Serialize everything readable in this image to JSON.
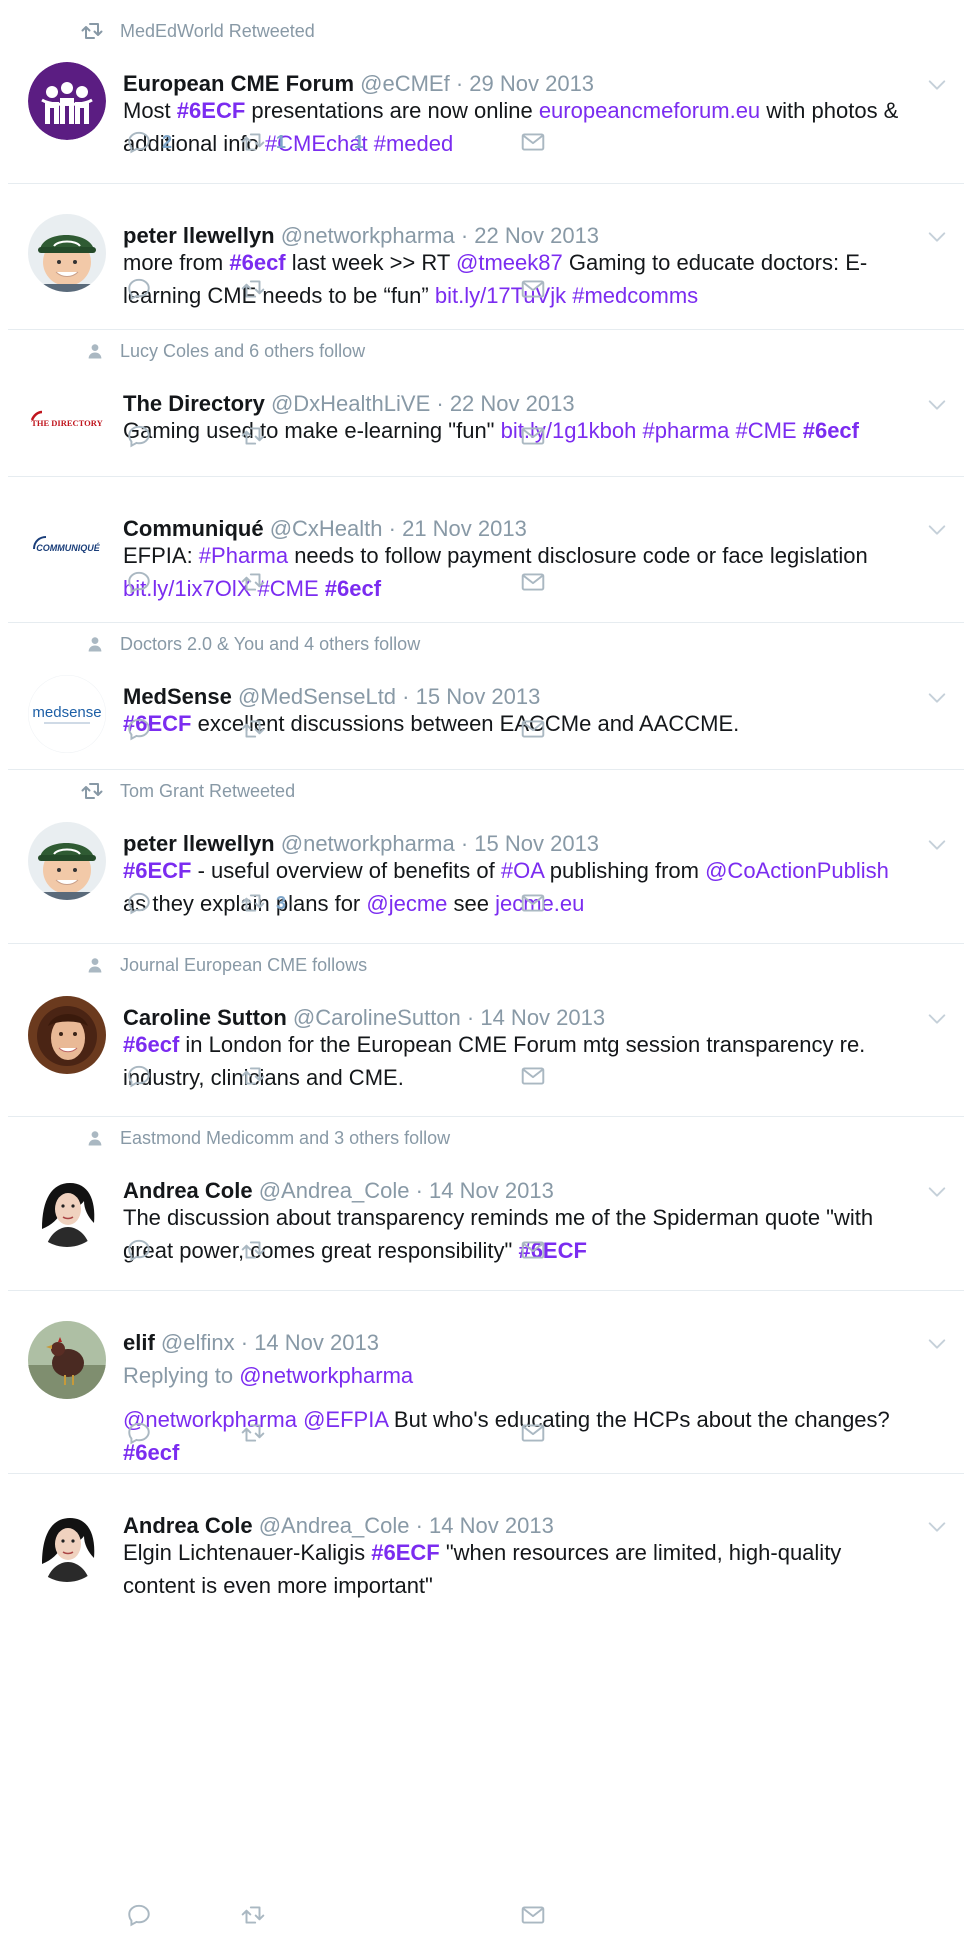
{
  "timeline": [
    {
      "context": {
        "type": "retweet",
        "text": "MedEdWorld Retweeted"
      },
      "avatar": "ecf-logo",
      "name": "European CME Forum",
      "handle": "@eCMEf",
      "date": "· 29 Nov 2013",
      "body": [
        [
          {
            "t": "Most "
          },
          {
            "t": "#6ECF",
            "c": "tag b"
          },
          {
            "t": " presentations are now online "
          },
          {
            "t": "europeancmeforum.eu",
            "c": "link"
          },
          {
            "t": " with photos &"
          }
        ],
        [
          {
            "t": "additional info "
          },
          {
            "t": "#CMEchat",
            "c": "tag"
          },
          {
            "t": " "
          },
          {
            "t": "#meded",
            "c": "tag"
          }
        ]
      ],
      "counts": {
        "replies": "2",
        "retweets": "1",
        "likes": "1"
      }
    },
    {
      "avatar": "peter-photo",
      "name": "peter llewellyn",
      "handle": "@networkpharma",
      "date": "· 22 Nov 2013",
      "body": [
        [
          {
            "t": "more from "
          },
          {
            "t": "#6ecf",
            "c": "tag b"
          },
          {
            "t": " last week >> RT "
          },
          {
            "t": "@tmeek87",
            "c": "link"
          },
          {
            "t": " Gaming to educate doctors: E-"
          }
        ],
        [
          {
            "t": "learning CME needs to be “fun” "
          },
          {
            "t": "bit.ly/17TuVjk",
            "c": "link"
          },
          {
            "t": " "
          },
          {
            "t": "#medcomms",
            "c": "tag"
          }
        ]
      ],
      "counts": {
        "replies": "",
        "retweets": "",
        "likes": ""
      }
    },
    {
      "context": {
        "type": "follow",
        "text": "Lucy Coles and 6 others follow"
      },
      "avatar": "directory-logo",
      "avatar_text": "THE DIRECTORY",
      "name": "The Directory",
      "handle": "@DxHealthLiVE",
      "date": "· 22 Nov 2013",
      "body": [
        [
          {
            "t": "Gaming used to make e-learning \"fun\" "
          },
          {
            "t": "bit.ly/1g1kboh",
            "c": "link"
          },
          {
            "t": " "
          },
          {
            "t": "#pharma",
            "c": "tag"
          },
          {
            "t": " "
          },
          {
            "t": "#CME",
            "c": "tag"
          },
          {
            "t": " "
          },
          {
            "t": "#6ecf",
            "c": "tag b"
          }
        ]
      ],
      "counts": {
        "replies": "",
        "retweets": "",
        "likes": ""
      }
    },
    {
      "avatar": "communique-logo",
      "avatar_text": "COMMUNIQUÉ",
      "name": "Communiqué",
      "handle": "@CxHealth",
      "date": "· 21 Nov 2013",
      "body": [
        [
          {
            "t": "EFPIA: "
          },
          {
            "t": "#Pharma",
            "c": "tag"
          },
          {
            "t": " needs to follow payment disclosure code or face legislation"
          }
        ],
        [
          {
            "t": "bit.ly/1ix7OlX",
            "c": "link"
          },
          {
            "t": " "
          },
          {
            "t": "#CME",
            "c": "tag"
          },
          {
            "t": " "
          },
          {
            "t": "#6ecf",
            "c": "tag b"
          }
        ]
      ],
      "counts": {
        "replies": "",
        "retweets": "",
        "likes": ""
      }
    },
    {
      "context": {
        "type": "follow",
        "text": "Doctors 2.0 & You and 4 others follow"
      },
      "avatar": "medsense-logo",
      "avatar_text": "medsense",
      "name": "MedSense",
      "handle": "@MedSenseLtd",
      "date": "· 15 Nov 2013",
      "body": [
        [
          {
            "t": "#6ECF",
            "c": "tag b"
          },
          {
            "t": " excellent discussions between EACCMe and AACCME."
          }
        ]
      ],
      "counts": {
        "replies": "",
        "retweets": "",
        "likes": ""
      }
    },
    {
      "context": {
        "type": "retweet",
        "text": "Tom Grant Retweeted"
      },
      "avatar": "peter-photo",
      "name": "peter llewellyn",
      "handle": "@networkpharma",
      "date": "· 15 Nov 2013",
      "body": [
        [
          {
            "t": "#6ECF",
            "c": "tag b"
          },
          {
            "t": " - useful overview of benefits of "
          },
          {
            "t": "#OA",
            "c": "tag"
          },
          {
            "t": " publishing from "
          },
          {
            "t": "@CoActionPublish",
            "c": "link"
          }
        ],
        [
          {
            "t": "as they explain plans for "
          },
          {
            "t": "@jecme",
            "c": "link"
          },
          {
            "t": " see "
          },
          {
            "t": "jecme.eu",
            "c": "link"
          }
        ]
      ],
      "counts": {
        "replies": "",
        "retweets": "3",
        "likes": ""
      }
    },
    {
      "context": {
        "type": "follow",
        "text": "Journal European CME follows"
      },
      "avatar": "caroline-photo",
      "name": "Caroline Sutton",
      "handle": "@CarolineSutton",
      "date": "· 14 Nov 2013",
      "body": [
        [
          {
            "t": "#6ecf",
            "c": "tag b"
          },
          {
            "t": " in London for the European CME Forum mtg session transparency re."
          }
        ],
        [
          {
            "t": "industry, clinicians and CME."
          }
        ]
      ],
      "counts": {
        "replies": "",
        "retweets": "",
        "likes": ""
      }
    },
    {
      "context": {
        "type": "follow",
        "text": "Eastmond Medicomm and 3 others follow"
      },
      "avatar": "andrea-photo",
      "name": "Andrea Cole",
      "handle": "@Andrea_Cole",
      "date": "· 14 Nov 2013",
      "body": [
        [
          {
            "t": "The discussion about transparency reminds me of the Spiderman quote \"with"
          }
        ],
        [
          {
            "t": "great power, comes great responsibility\" "
          },
          {
            "t": "#6ECF",
            "c": "tag b"
          }
        ]
      ],
      "counts": {
        "replies": "",
        "retweets": "",
        "likes": ""
      }
    },
    {
      "avatar": "elif-photo",
      "name": "elif",
      "handle": "@elfinx",
      "date": "· 14 Nov 2013",
      "replying": {
        "prefix": "Replying to ",
        "to": "@networkpharma"
      },
      "body": [
        [
          {
            "t": "@networkpharma",
            "c": "link"
          },
          {
            "t": " "
          },
          {
            "t": "@EFPIA",
            "c": "link"
          },
          {
            "t": " But who's educating the HCPs about the changes?"
          }
        ],
        [
          {
            "t": "#6ecf",
            "c": "tag b"
          }
        ]
      ],
      "counts": {
        "replies": "",
        "retweets": "",
        "likes": ""
      }
    },
    {
      "avatar": "andrea-photo",
      "name": "Andrea Cole",
      "handle": "@Andrea_Cole",
      "date": "· 14 Nov 2013",
      "body": [
        [
          {
            "t": "Elgin Lichtenauer-Kaligis "
          },
          {
            "t": "#6ECF",
            "c": "tag b"
          },
          {
            "t": " \"when resources are limited, high-quality"
          }
        ],
        [
          {
            "t": "content is even more important\""
          }
        ]
      ],
      "counts": {
        "replies": "",
        "retweets": "",
        "likes": ""
      }
    }
  ],
  "colors": {
    "link": "#7b2cf0",
    "muted": "#8899a6",
    "icon": "#aab8c2",
    "border": "#e6ecf0"
  },
  "icons": {
    "reply": "reply-icon",
    "retweet": "retweet-icon",
    "like": "like-icon",
    "dm": "envelope-icon",
    "caret": "chevron-down-icon",
    "follow": "person-icon"
  }
}
